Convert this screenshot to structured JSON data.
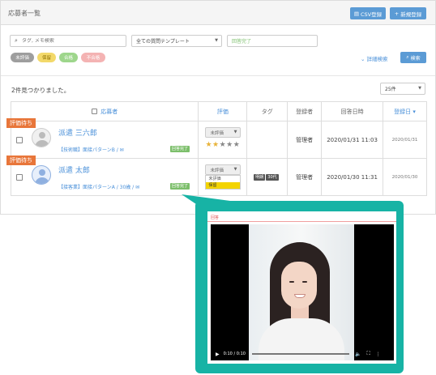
{
  "header": {
    "title": "応募者一覧",
    "csv_label": "CSV登録",
    "new_label": "新規登録"
  },
  "search": {
    "placeholder": "タグ, メモ検索"
  },
  "filters": {
    "template": "全ての質問テンプレート",
    "status": "回答完了",
    "chips": [
      "未評価",
      "保留",
      "合格",
      "不合格"
    ],
    "detail_link": "詳細検索",
    "search_button": "検索"
  },
  "results": {
    "count_text": "2件見つかりました。",
    "per_page": "25件"
  },
  "table": {
    "headers": {
      "name": "応募者",
      "score": "評価",
      "tag": "タグ",
      "registrar": "登録者",
      "answered": "回答日時",
      "registered": "登録日"
    },
    "rows": [
      {
        "ribbon": "評価待ち",
        "name": "派遣 三六郎",
        "meta": "【技術職】面接パターンB / ✉",
        "status": "回答完了",
        "score_label": "未評価",
        "stars_filled": 2,
        "stars_total": 5,
        "tags": [],
        "registrar": "管理者",
        "answered": "2020/01/31 11:03",
        "registered": "2020/01/31"
      },
      {
        "ribbon": "評価待ち",
        "name": "派遣 太郎",
        "meta": "【接客業】面接パターンA / 30歳 / ✉",
        "status": "回答完了",
        "score_label": "未評価",
        "dropdown": [
          "未評価",
          "保留"
        ],
        "tags": [
          "明朗",
          "30代"
        ],
        "registrar": "管理者",
        "answered": "2020/01/30 11:31",
        "registered": "2020/01/30"
      }
    ]
  },
  "video_popup": {
    "label": "回答",
    "time": "0:10 / 0:10"
  },
  "colors": {
    "accent": "#5b9bd5",
    "ribbon": "#e8763a",
    "popup": "#17b3a5",
    "done": "#7cbf6b"
  }
}
